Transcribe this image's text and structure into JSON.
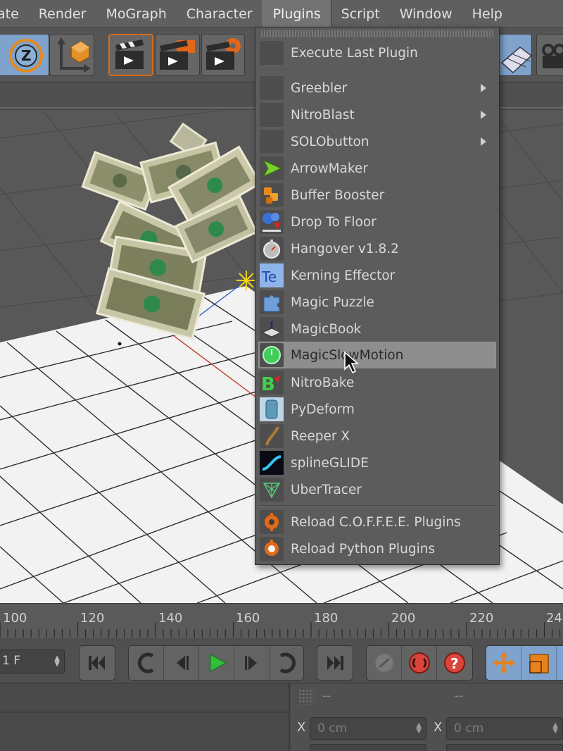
{
  "menubar": {
    "items": [
      "ate",
      "Render",
      "MoGraph",
      "Character",
      "Plugins",
      "Script",
      "Window",
      "Help"
    ],
    "active": "Plugins"
  },
  "plugins_menu": {
    "execute_last": "Execute Last Plugin",
    "submenus": [
      "Greebler",
      "NitroBlast",
      "SOLObutton"
    ],
    "plugins": [
      {
        "label": "ArrowMaker",
        "icon": "arrow-icon"
      },
      {
        "label": "Buffer Booster",
        "icon": "buffer-booster-icon"
      },
      {
        "label": "Drop To Floor",
        "icon": "drop-to-floor-icon"
      },
      {
        "label": "Hangover v1.8.2",
        "icon": "stopwatch-icon"
      },
      {
        "label": "Kerning Effector",
        "icon": "kerning-te-icon"
      },
      {
        "label": "Magic Puzzle",
        "icon": "puzzle-icon"
      },
      {
        "label": "MagicBook",
        "icon": "magicbook-icon"
      },
      {
        "label": "MagicSlowMotion",
        "icon": "slowmotion-icon",
        "highlighted": true
      },
      {
        "label": "NitroBake",
        "icon": "nitrobake-icon"
      },
      {
        "label": "PyDeform",
        "icon": "pydeform-icon"
      },
      {
        "label": "Reeper X",
        "icon": "reeper-icon"
      },
      {
        "label": "splineGLIDE",
        "icon": "splineglide-icon"
      },
      {
        "label": "UberTracer",
        "icon": "ubertracer-icon"
      }
    ],
    "reload": [
      "Reload C.O.F.F.E.E. Plugins",
      "Reload Python Plugins"
    ]
  },
  "timeline": {
    "ticks": [
      "100",
      "120",
      "140",
      "160",
      "180",
      "200",
      "220",
      "24"
    ]
  },
  "transport": {
    "current_frame": "1 F"
  },
  "coordinates": {
    "header_left": "--",
    "header_right": "--",
    "x_label": "X",
    "x_pos": "0 cm",
    "x_size": "0 cm"
  },
  "colors": {
    "menu_bg": "#5f5f5f",
    "menu_highlight": "#8e8e8e",
    "play_green": "#2fbf3a",
    "record_red": "#d9453a",
    "toolbar_blue": "#7fa3cc"
  }
}
